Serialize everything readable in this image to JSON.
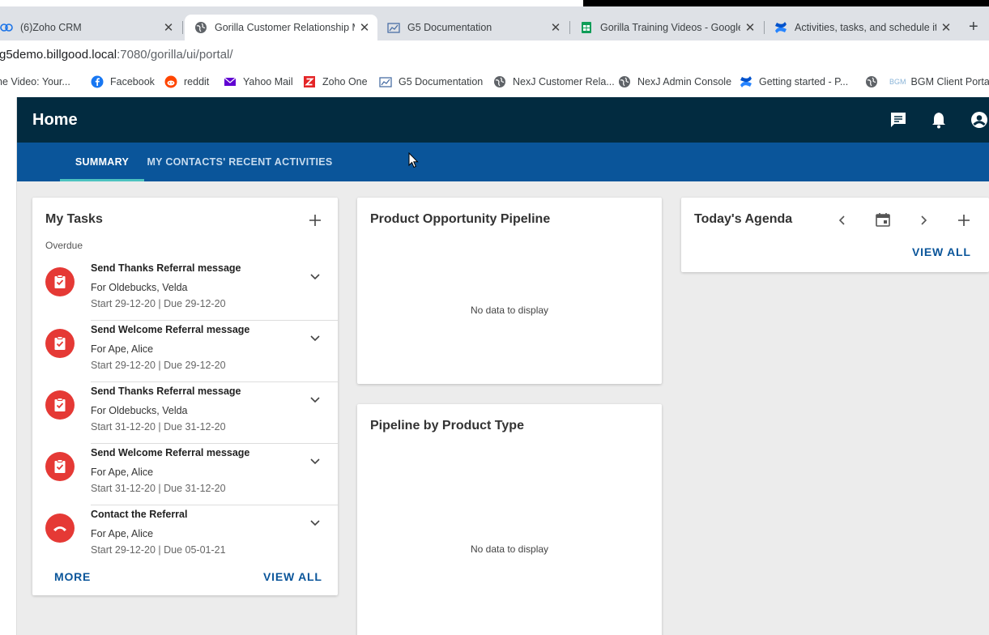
{
  "browser": {
    "tabs": [
      {
        "title": "(6)Zoho CRM",
        "icon": "zoho-crm-icon"
      },
      {
        "title": "Gorilla Customer Relationship Ma",
        "icon": "globe-icon",
        "active": true
      },
      {
        "title": "G5 Documentation",
        "icon": "g5-docs-icon"
      },
      {
        "title": "Gorilla Training Videos - Google S",
        "icon": "google-sheets-icon"
      },
      {
        "title": "Activities, tasks, and schedule ite",
        "icon": "confluence-icon"
      }
    ],
    "close_glyph": "✕",
    "new_tab_glyph": "+",
    "url_host": "g5demo.billgood.local",
    "url_path": ":7080/gorilla/ui/portal/",
    "bookmarks": [
      {
        "label": "ne Video: Your...",
        "icon": "none"
      },
      {
        "label": "Facebook",
        "icon": "facebook-icon"
      },
      {
        "label": "reddit",
        "icon": "reddit-icon"
      },
      {
        "label": "Yahoo Mail",
        "icon": "yahoo-mail-icon"
      },
      {
        "label": "Zoho One",
        "icon": "zoho-one-icon"
      },
      {
        "label": "G5 Documentation",
        "icon": "g5-docs-icon"
      },
      {
        "label": "NexJ Customer Rela...",
        "icon": "globe-icon"
      },
      {
        "label": "NexJ Admin Console",
        "icon": "globe-icon"
      },
      {
        "label": "Getting started - P...",
        "icon": "confluence-icon"
      },
      {
        "label": "BGM Client Portal",
        "icon": "bgm-icon",
        "prefix": "BGM"
      }
    ]
  },
  "app": {
    "page_title": "Home",
    "header_icons": [
      "chat-icon",
      "bell-icon",
      "account-icon"
    ],
    "nav_tabs": [
      {
        "label": "SUMMARY",
        "active": true
      },
      {
        "label": "MY CONTACTS' RECENT ACTIVITIES",
        "active": false
      }
    ],
    "my_tasks": {
      "title": "My Tasks",
      "section": "Overdue",
      "tasks": [
        {
          "title": "Send Thanks Referral message",
          "for": "For Oldebucks, Velda",
          "dates": "Start 29-12-20 | Due 29-12-20",
          "icon": "clipboard-check-icon"
        },
        {
          "title": "Send Welcome Referral message",
          "for": "For Ape, Alice",
          "dates": "Start 29-12-20 | Due 29-12-20",
          "icon": "clipboard-check-icon"
        },
        {
          "title": "Send Thanks Referral message",
          "for": "For Oldebucks, Velda",
          "dates": "Start 31-12-20 | Due 31-12-20",
          "icon": "clipboard-check-icon"
        },
        {
          "title": "Send Welcome Referral message",
          "for": "For Ape, Alice",
          "dates": "Start 31-12-20 | Due 31-12-20",
          "icon": "clipboard-check-icon"
        },
        {
          "title": "Contact the Referral",
          "for": "For Ape, Alice",
          "dates": "Start 29-12-20 | Due 05-01-21",
          "icon": "phone-icon"
        }
      ],
      "more_label": "MORE",
      "view_all_label": "VIEW ALL"
    },
    "pipeline": {
      "title": "Product Opportunity Pipeline",
      "empty": "No data to display"
    },
    "pipeline_by_type": {
      "title": "Pipeline by Product Type",
      "empty": "No data to display"
    },
    "agenda": {
      "title": "Today's Agenda",
      "view_all_label": "VIEW ALL"
    },
    "colors": {
      "header": "#022b40",
      "nav": "#0a559a",
      "accent": "#4dc3c0",
      "task_icon": "#e53935"
    }
  }
}
